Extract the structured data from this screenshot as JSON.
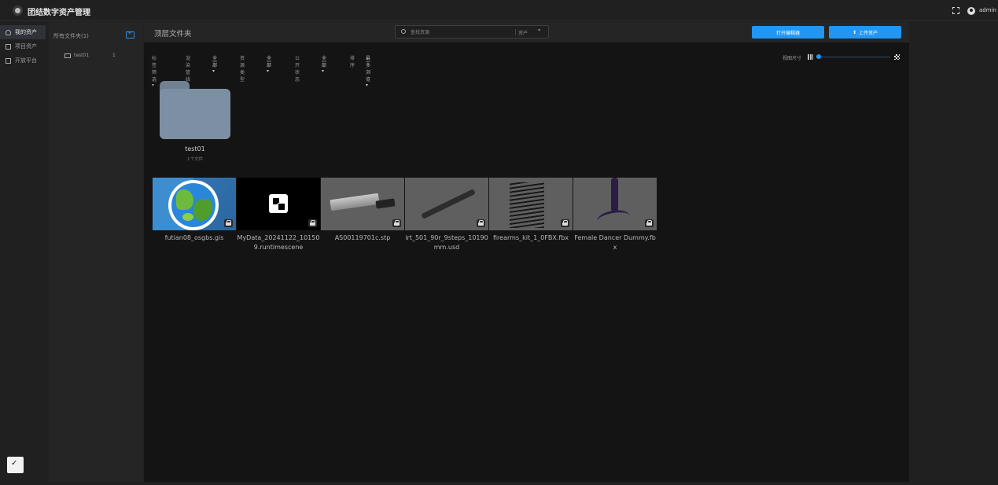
{
  "app": {
    "title": "团结数字资产管理",
    "username": "admin"
  },
  "nav": {
    "items": [
      {
        "label": "我的资产",
        "icon": "user-icon",
        "active": true
      },
      {
        "label": "项目资产",
        "icon": "document-icon",
        "active": false
      },
      {
        "label": "开放平台",
        "icon": "folder-icon",
        "active": false
      }
    ]
  },
  "folder_panel": {
    "title": "所有文件夹(1)",
    "items": [
      {
        "name": "test01",
        "count": "1"
      }
    ]
  },
  "main": {
    "title": "顶层文件夹",
    "search": {
      "placeholder": "查找资源",
      "scope": "资产"
    },
    "open_button": "打开编辑器",
    "upload_button": "上传资产",
    "filters": [
      {
        "label": "标签筛选",
        "value": ""
      },
      {
        "label": "渲染管线",
        "value": "全部"
      },
      {
        "label": "资源类型",
        "value": "全部"
      },
      {
        "label": "公开状态",
        "value": "全部"
      },
      {
        "label": "排序",
        "value": "最多浏览"
      }
    ],
    "size_label": "视图尺寸"
  },
  "folders": [
    {
      "name": "test01",
      "subtitle": "1个文件"
    }
  ],
  "assets": [
    {
      "name": "futian08_osgbs.gis",
      "thumb": "globe"
    },
    {
      "name": "MyData_20241122_101509.runtimescene",
      "thumb": "scene"
    },
    {
      "name": "AS00119701c.stp",
      "thumb": "stp"
    },
    {
      "name": "irt_501_90r_9steps_10190mm.usd",
      "thumb": "usd"
    },
    {
      "name": "firearms_kit_1_0FBX.fbx",
      "thumb": "fbx"
    },
    {
      "name": "Female Dancer Dummy.fbx",
      "thumb": "dancer"
    }
  ]
}
